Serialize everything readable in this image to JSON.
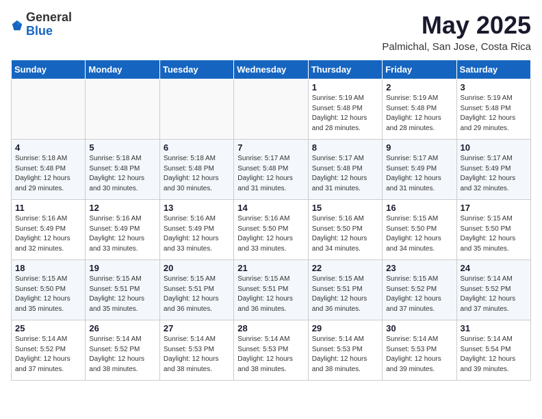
{
  "header": {
    "logo_general": "General",
    "logo_blue": "Blue",
    "month": "May 2025",
    "location": "Palmichal, San Jose, Costa Rica"
  },
  "days_of_week": [
    "Sunday",
    "Monday",
    "Tuesday",
    "Wednesday",
    "Thursday",
    "Friday",
    "Saturday"
  ],
  "weeks": [
    [
      {
        "day": "",
        "info": ""
      },
      {
        "day": "",
        "info": ""
      },
      {
        "day": "",
        "info": ""
      },
      {
        "day": "",
        "info": ""
      },
      {
        "day": "1",
        "sunrise": "5:19 AM",
        "sunset": "5:48 PM",
        "daylight": "12 hours and 28 minutes."
      },
      {
        "day": "2",
        "sunrise": "5:19 AM",
        "sunset": "5:48 PM",
        "daylight": "12 hours and 28 minutes."
      },
      {
        "day": "3",
        "sunrise": "5:19 AM",
        "sunset": "5:48 PM",
        "daylight": "12 hours and 29 minutes."
      }
    ],
    [
      {
        "day": "4",
        "sunrise": "5:18 AM",
        "sunset": "5:48 PM",
        "daylight": "12 hours and 29 minutes."
      },
      {
        "day": "5",
        "sunrise": "5:18 AM",
        "sunset": "5:48 PM",
        "daylight": "12 hours and 30 minutes."
      },
      {
        "day": "6",
        "sunrise": "5:18 AM",
        "sunset": "5:48 PM",
        "daylight": "12 hours and 30 minutes."
      },
      {
        "day": "7",
        "sunrise": "5:17 AM",
        "sunset": "5:48 PM",
        "daylight": "12 hours and 31 minutes."
      },
      {
        "day": "8",
        "sunrise": "5:17 AM",
        "sunset": "5:48 PM",
        "daylight": "12 hours and 31 minutes."
      },
      {
        "day": "9",
        "sunrise": "5:17 AM",
        "sunset": "5:49 PM",
        "daylight": "12 hours and 31 minutes."
      },
      {
        "day": "10",
        "sunrise": "5:17 AM",
        "sunset": "5:49 PM",
        "daylight": "12 hours and 32 minutes."
      }
    ],
    [
      {
        "day": "11",
        "sunrise": "5:16 AM",
        "sunset": "5:49 PM",
        "daylight": "12 hours and 32 minutes."
      },
      {
        "day": "12",
        "sunrise": "5:16 AM",
        "sunset": "5:49 PM",
        "daylight": "12 hours and 33 minutes."
      },
      {
        "day": "13",
        "sunrise": "5:16 AM",
        "sunset": "5:49 PM",
        "daylight": "12 hours and 33 minutes."
      },
      {
        "day": "14",
        "sunrise": "5:16 AM",
        "sunset": "5:50 PM",
        "daylight": "12 hours and 33 minutes."
      },
      {
        "day": "15",
        "sunrise": "5:16 AM",
        "sunset": "5:50 PM",
        "daylight": "12 hours and 34 minutes."
      },
      {
        "day": "16",
        "sunrise": "5:15 AM",
        "sunset": "5:50 PM",
        "daylight": "12 hours and 34 minutes."
      },
      {
        "day": "17",
        "sunrise": "5:15 AM",
        "sunset": "5:50 PM",
        "daylight": "12 hours and 35 minutes."
      }
    ],
    [
      {
        "day": "18",
        "sunrise": "5:15 AM",
        "sunset": "5:50 PM",
        "daylight": "12 hours and 35 minutes."
      },
      {
        "day": "19",
        "sunrise": "5:15 AM",
        "sunset": "5:51 PM",
        "daylight": "12 hours and 35 minutes."
      },
      {
        "day": "20",
        "sunrise": "5:15 AM",
        "sunset": "5:51 PM",
        "daylight": "12 hours and 36 minutes."
      },
      {
        "day": "21",
        "sunrise": "5:15 AM",
        "sunset": "5:51 PM",
        "daylight": "12 hours and 36 minutes."
      },
      {
        "day": "22",
        "sunrise": "5:15 AM",
        "sunset": "5:51 PM",
        "daylight": "12 hours and 36 minutes."
      },
      {
        "day": "23",
        "sunrise": "5:15 AM",
        "sunset": "5:52 PM",
        "daylight": "12 hours and 37 minutes."
      },
      {
        "day": "24",
        "sunrise": "5:14 AM",
        "sunset": "5:52 PM",
        "daylight": "12 hours and 37 minutes."
      }
    ],
    [
      {
        "day": "25",
        "sunrise": "5:14 AM",
        "sunset": "5:52 PM",
        "daylight": "12 hours and 37 minutes."
      },
      {
        "day": "26",
        "sunrise": "5:14 AM",
        "sunset": "5:52 PM",
        "daylight": "12 hours and 38 minutes."
      },
      {
        "day": "27",
        "sunrise": "5:14 AM",
        "sunset": "5:53 PM",
        "daylight": "12 hours and 38 minutes."
      },
      {
        "day": "28",
        "sunrise": "5:14 AM",
        "sunset": "5:53 PM",
        "daylight": "12 hours and 38 minutes."
      },
      {
        "day": "29",
        "sunrise": "5:14 AM",
        "sunset": "5:53 PM",
        "daylight": "12 hours and 38 minutes."
      },
      {
        "day": "30",
        "sunrise": "5:14 AM",
        "sunset": "5:53 PM",
        "daylight": "12 hours and 39 minutes."
      },
      {
        "day": "31",
        "sunrise": "5:14 AM",
        "sunset": "5:54 PM",
        "daylight": "12 hours and 39 minutes."
      }
    ]
  ]
}
